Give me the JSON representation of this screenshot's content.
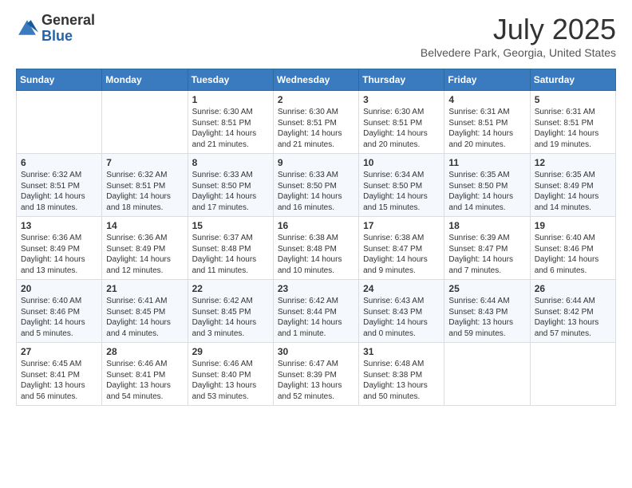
{
  "header": {
    "logo_general": "General",
    "logo_blue": "Blue",
    "month_title": "July 2025",
    "location": "Belvedere Park, Georgia, United States"
  },
  "weekdays": [
    "Sunday",
    "Monday",
    "Tuesday",
    "Wednesday",
    "Thursday",
    "Friday",
    "Saturday"
  ],
  "weeks": [
    [
      {
        "day": "",
        "sunrise": "",
        "sunset": "",
        "daylight": ""
      },
      {
        "day": "",
        "sunrise": "",
        "sunset": "",
        "daylight": ""
      },
      {
        "day": "1",
        "sunrise": "Sunrise: 6:30 AM",
        "sunset": "Sunset: 8:51 PM",
        "daylight": "Daylight: 14 hours and 21 minutes."
      },
      {
        "day": "2",
        "sunrise": "Sunrise: 6:30 AM",
        "sunset": "Sunset: 8:51 PM",
        "daylight": "Daylight: 14 hours and 21 minutes."
      },
      {
        "day": "3",
        "sunrise": "Sunrise: 6:30 AM",
        "sunset": "Sunset: 8:51 PM",
        "daylight": "Daylight: 14 hours and 20 minutes."
      },
      {
        "day": "4",
        "sunrise": "Sunrise: 6:31 AM",
        "sunset": "Sunset: 8:51 PM",
        "daylight": "Daylight: 14 hours and 20 minutes."
      },
      {
        "day": "5",
        "sunrise": "Sunrise: 6:31 AM",
        "sunset": "Sunset: 8:51 PM",
        "daylight": "Daylight: 14 hours and 19 minutes."
      }
    ],
    [
      {
        "day": "6",
        "sunrise": "Sunrise: 6:32 AM",
        "sunset": "Sunset: 8:51 PM",
        "daylight": "Daylight: 14 hours and 18 minutes."
      },
      {
        "day": "7",
        "sunrise": "Sunrise: 6:32 AM",
        "sunset": "Sunset: 8:51 PM",
        "daylight": "Daylight: 14 hours and 18 minutes."
      },
      {
        "day": "8",
        "sunrise": "Sunrise: 6:33 AM",
        "sunset": "Sunset: 8:50 PM",
        "daylight": "Daylight: 14 hours and 17 minutes."
      },
      {
        "day": "9",
        "sunrise": "Sunrise: 6:33 AM",
        "sunset": "Sunset: 8:50 PM",
        "daylight": "Daylight: 14 hours and 16 minutes."
      },
      {
        "day": "10",
        "sunrise": "Sunrise: 6:34 AM",
        "sunset": "Sunset: 8:50 PM",
        "daylight": "Daylight: 14 hours and 15 minutes."
      },
      {
        "day": "11",
        "sunrise": "Sunrise: 6:35 AM",
        "sunset": "Sunset: 8:50 PM",
        "daylight": "Daylight: 14 hours and 14 minutes."
      },
      {
        "day": "12",
        "sunrise": "Sunrise: 6:35 AM",
        "sunset": "Sunset: 8:49 PM",
        "daylight": "Daylight: 14 hours and 14 minutes."
      }
    ],
    [
      {
        "day": "13",
        "sunrise": "Sunrise: 6:36 AM",
        "sunset": "Sunset: 8:49 PM",
        "daylight": "Daylight: 14 hours and 13 minutes."
      },
      {
        "day": "14",
        "sunrise": "Sunrise: 6:36 AM",
        "sunset": "Sunset: 8:49 PM",
        "daylight": "Daylight: 14 hours and 12 minutes."
      },
      {
        "day": "15",
        "sunrise": "Sunrise: 6:37 AM",
        "sunset": "Sunset: 8:48 PM",
        "daylight": "Daylight: 14 hours and 11 minutes."
      },
      {
        "day": "16",
        "sunrise": "Sunrise: 6:38 AM",
        "sunset": "Sunset: 8:48 PM",
        "daylight": "Daylight: 14 hours and 10 minutes."
      },
      {
        "day": "17",
        "sunrise": "Sunrise: 6:38 AM",
        "sunset": "Sunset: 8:47 PM",
        "daylight": "Daylight: 14 hours and 9 minutes."
      },
      {
        "day": "18",
        "sunrise": "Sunrise: 6:39 AM",
        "sunset": "Sunset: 8:47 PM",
        "daylight": "Daylight: 14 hours and 7 minutes."
      },
      {
        "day": "19",
        "sunrise": "Sunrise: 6:40 AM",
        "sunset": "Sunset: 8:46 PM",
        "daylight": "Daylight: 14 hours and 6 minutes."
      }
    ],
    [
      {
        "day": "20",
        "sunrise": "Sunrise: 6:40 AM",
        "sunset": "Sunset: 8:46 PM",
        "daylight": "Daylight: 14 hours and 5 minutes."
      },
      {
        "day": "21",
        "sunrise": "Sunrise: 6:41 AM",
        "sunset": "Sunset: 8:45 PM",
        "daylight": "Daylight: 14 hours and 4 minutes."
      },
      {
        "day": "22",
        "sunrise": "Sunrise: 6:42 AM",
        "sunset": "Sunset: 8:45 PM",
        "daylight": "Daylight: 14 hours and 3 minutes."
      },
      {
        "day": "23",
        "sunrise": "Sunrise: 6:42 AM",
        "sunset": "Sunset: 8:44 PM",
        "daylight": "Daylight: 14 hours and 1 minute."
      },
      {
        "day": "24",
        "sunrise": "Sunrise: 6:43 AM",
        "sunset": "Sunset: 8:43 PM",
        "daylight": "Daylight: 14 hours and 0 minutes."
      },
      {
        "day": "25",
        "sunrise": "Sunrise: 6:44 AM",
        "sunset": "Sunset: 8:43 PM",
        "daylight": "Daylight: 13 hours and 59 minutes."
      },
      {
        "day": "26",
        "sunrise": "Sunrise: 6:44 AM",
        "sunset": "Sunset: 8:42 PM",
        "daylight": "Daylight: 13 hours and 57 minutes."
      }
    ],
    [
      {
        "day": "27",
        "sunrise": "Sunrise: 6:45 AM",
        "sunset": "Sunset: 8:41 PM",
        "daylight": "Daylight: 13 hours and 56 minutes."
      },
      {
        "day": "28",
        "sunrise": "Sunrise: 6:46 AM",
        "sunset": "Sunset: 8:41 PM",
        "daylight": "Daylight: 13 hours and 54 minutes."
      },
      {
        "day": "29",
        "sunrise": "Sunrise: 6:46 AM",
        "sunset": "Sunset: 8:40 PM",
        "daylight": "Daylight: 13 hours and 53 minutes."
      },
      {
        "day": "30",
        "sunrise": "Sunrise: 6:47 AM",
        "sunset": "Sunset: 8:39 PM",
        "daylight": "Daylight: 13 hours and 52 minutes."
      },
      {
        "day": "31",
        "sunrise": "Sunrise: 6:48 AM",
        "sunset": "Sunset: 8:38 PM",
        "daylight": "Daylight: 13 hours and 50 minutes."
      },
      {
        "day": "",
        "sunrise": "",
        "sunset": "",
        "daylight": ""
      },
      {
        "day": "",
        "sunrise": "",
        "sunset": "",
        "daylight": ""
      }
    ]
  ]
}
